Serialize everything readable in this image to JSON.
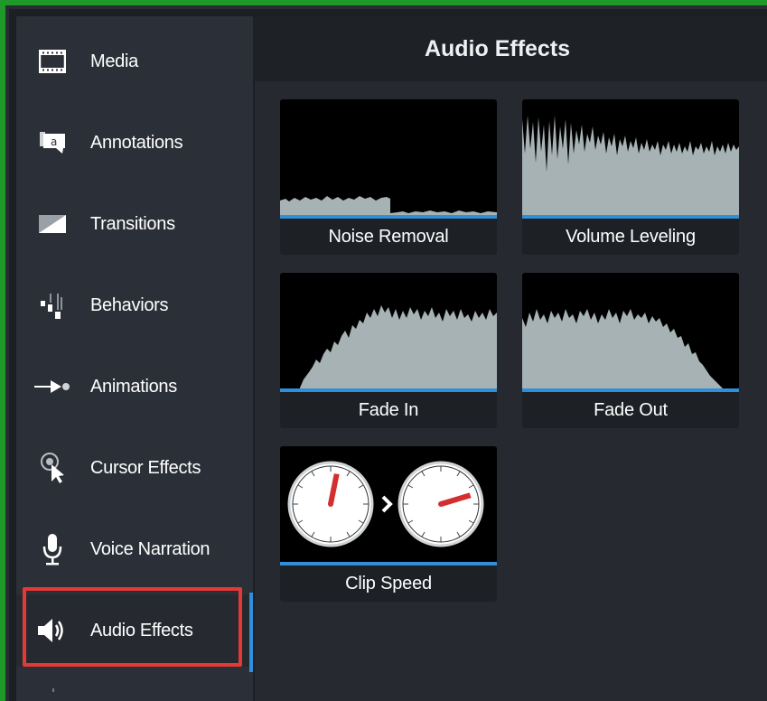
{
  "sidebar": {
    "items": [
      {
        "label": "Media",
        "icon": "film-icon"
      },
      {
        "label": "Annotations",
        "icon": "annotation-callout-icon"
      },
      {
        "label": "Transitions",
        "icon": "transition-icon"
      },
      {
        "label": "Behaviors",
        "icon": "behaviors-icon"
      },
      {
        "label": "Animations",
        "icon": "animation-arrow-icon"
      },
      {
        "label": "Cursor Effects",
        "icon": "cursor-effects-icon"
      },
      {
        "label": "Voice Narration",
        "icon": "microphone-icon"
      },
      {
        "label": "Audio Effects",
        "icon": "speaker-icon",
        "active": true
      }
    ]
  },
  "main": {
    "title": "Audio Effects",
    "effects": [
      {
        "label": "Noise Removal",
        "icon": "noise-removal-waveform"
      },
      {
        "label": "Volume Leveling",
        "icon": "volume-leveling-waveform"
      },
      {
        "label": "Fade In",
        "icon": "fade-in-waveform"
      },
      {
        "label": "Fade Out",
        "icon": "fade-out-waveform"
      },
      {
        "label": "Clip Speed",
        "icon": "clip-speed-clocks"
      }
    ]
  },
  "colors": {
    "accent": "#2f8fd8",
    "highlight": "#e53935",
    "frame": "#1f9a2a",
    "waveform": "#a7b2b5",
    "clock_hand": "#d32f2f"
  }
}
